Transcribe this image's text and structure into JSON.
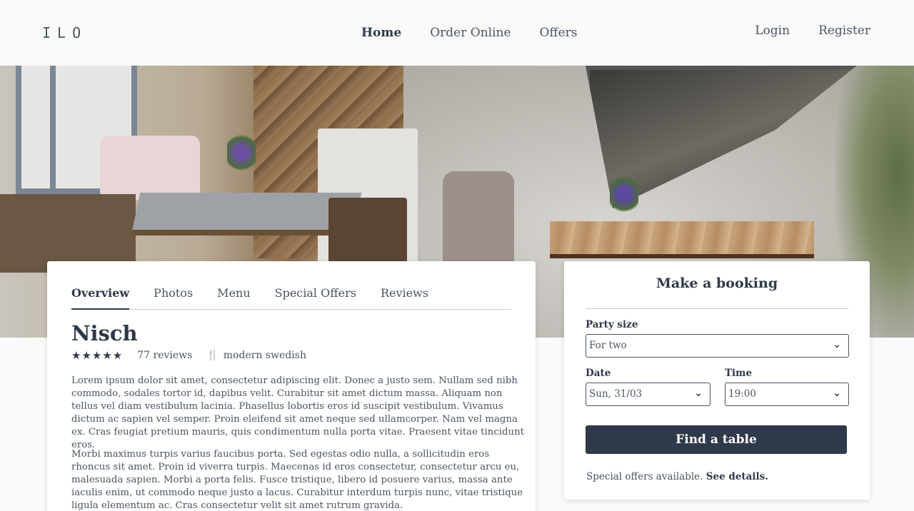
{
  "header": {
    "logo": "ILO",
    "nav": [
      "Home",
      "Order Online",
      "Offers"
    ],
    "auth": {
      "login": "Login",
      "register": "Register"
    }
  },
  "tabs": [
    "Overview",
    "Photos",
    "Menu",
    "Special Offers",
    "Reviews"
  ],
  "restaurant": {
    "name": "Nisch",
    "rating_stars": 5,
    "stars_text": "★★★★★",
    "reviews": "77 reviews",
    "cuisine": "modern swedish",
    "description": [
      "Lorem ipsum dolor sit amet, consectetur adipiscing elit. Donec a justo sem. Nullam sed nibh commodo, sodales tortor id, dapibus velit. Curabitur sit amet dictum massa. Aliquam non tellus vel diam vestibulum lacinia. Phasellus lobortis eros id suscipit vestibulum. Vivamus dictum ac sapien vel semper. Proin eleifend sit amet neque sed ullamcorper. Nam vel magna ex. Cras feugiat pretium mauris, quis condimentum nulla porta vitae. Praesent vitae tincidunt eros.",
      "Morbi maximus turpis varius faucibus porta. Sed egestas odio nulla, a sollicitudin eros rhoncus sit amet. Proin id viverra turpis. Maecenas id eros consectetur, consectetur arcu eu, malesuada sapien. Morbi a porta felis. Fusce tristique, libero id posuere varius, massa ante iaculis enim, ut commodo neque justo a lacus. Curabitur interdum turpis nunc, vitae tristique ligula elementum ac. Cras consectetur velit sit amet rutrum gravida."
    ]
  },
  "booking": {
    "title": "Make a booking",
    "party_label": "Party size",
    "party_value": "For two",
    "date_label": "Date",
    "date_value": "Sun, 31/03",
    "time_label": "Time",
    "time_value": "19:00",
    "button": "Find a table",
    "offers_text": "Special offers available.",
    "offers_link": "See details."
  },
  "icons": {
    "chevron": "chevron-down-icon",
    "cutlery": "cutlery-icon",
    "star": "star-icon"
  },
  "colors": {
    "primary": "#2e3a4a",
    "text": "#4a5563",
    "background": "#fafafa"
  }
}
